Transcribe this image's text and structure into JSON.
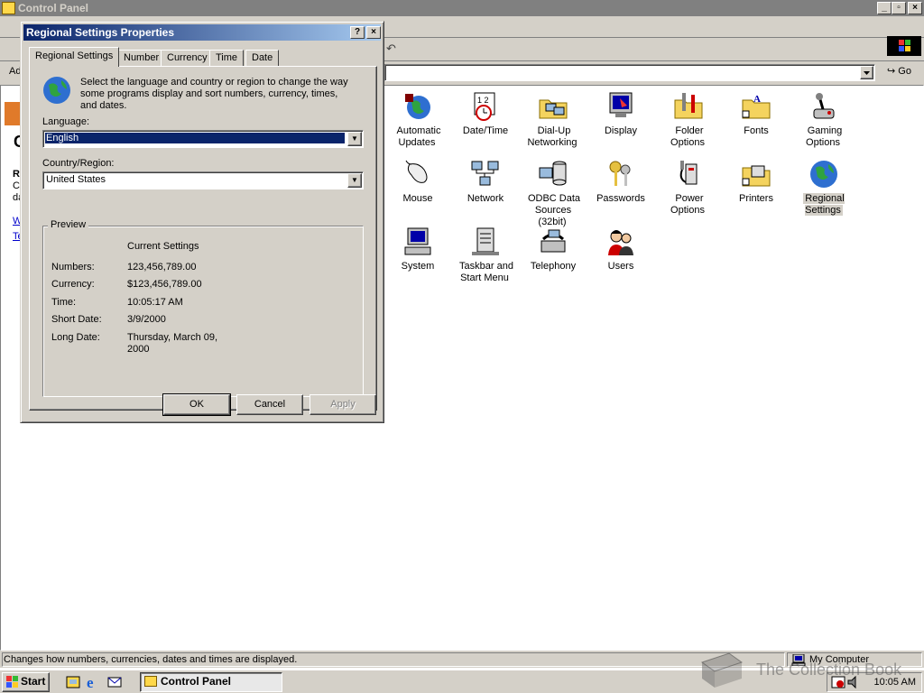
{
  "window": {
    "title": "Control Panel"
  },
  "address": {
    "label_partial": "Ad",
    "go_label": "Go"
  },
  "left_panel": {
    "title_partial": "C",
    "desc_title_partial": "R",
    "desc_lines_partial": [
      "Cl",
      "da"
    ],
    "links_partial": [
      "W",
      "Te"
    ]
  },
  "icons": [
    {
      "name": "automatic-updates",
      "label": "Automatic Updates"
    },
    {
      "name": "date-time",
      "label": "Date/Time"
    },
    {
      "name": "dial-up-networking",
      "label": "Dial-Up Networking"
    },
    {
      "name": "display",
      "label": "Display"
    },
    {
      "name": "folder-options",
      "label": "Folder Options"
    },
    {
      "name": "fonts",
      "label": "Fonts"
    },
    {
      "name": "gaming-options",
      "label": "Gaming Options"
    },
    {
      "name": "mouse",
      "label": "Mouse"
    },
    {
      "name": "network",
      "label": "Network"
    },
    {
      "name": "odbc",
      "label": "ODBC Data Sources (32bit)"
    },
    {
      "name": "passwords",
      "label": "Passwords"
    },
    {
      "name": "power-options",
      "label": "Power Options"
    },
    {
      "name": "printers",
      "label": "Printers"
    },
    {
      "name": "regional-settings",
      "label": "Regional Settings"
    },
    {
      "name": "system",
      "label": "System"
    },
    {
      "name": "taskbar-start-menu",
      "label": "Taskbar and Start Menu"
    },
    {
      "name": "telephony",
      "label": "Telephony"
    },
    {
      "name": "users",
      "label": "Users"
    }
  ],
  "dialog": {
    "title": "Regional Settings Properties",
    "help": "?",
    "tabs": [
      "Regional Settings",
      "Number",
      "Currency",
      "Time",
      "Date"
    ],
    "description": "Select the language and country or region to change the way some programs display and sort numbers, currency, times, and dates.",
    "language_label": "Language:",
    "language_value": "English",
    "country_label": "Country/Region:",
    "country_value": "United States",
    "preview": {
      "legend": "Preview",
      "heading": "Current Settings",
      "rows": [
        {
          "label": "Numbers:",
          "value": "123,456,789.00"
        },
        {
          "label": "Currency:",
          "value": "$123,456,789.00"
        },
        {
          "label": "Time:",
          "value": "10:05:17 AM"
        },
        {
          "label": "Short Date:",
          "value": "3/9/2000"
        },
        {
          "label": "Long Date:",
          "value": "Thursday, March 09, 2000"
        }
      ]
    },
    "buttons": {
      "ok": "OK",
      "cancel": "Cancel",
      "apply": "Apply"
    }
  },
  "statusbar": {
    "text": "Changes how numbers, currencies, dates and times are displayed.",
    "zone": "My Computer"
  },
  "taskbar": {
    "start": "Start",
    "task": "Control Panel",
    "clock": "10:05 AM"
  },
  "watermark": "The Collection Book",
  "colors": {
    "titlebar_active_start": "#0a246a",
    "titlebar_active_end": "#a6caf0",
    "face": "#d4d0c8",
    "selection": "#0a246a"
  }
}
